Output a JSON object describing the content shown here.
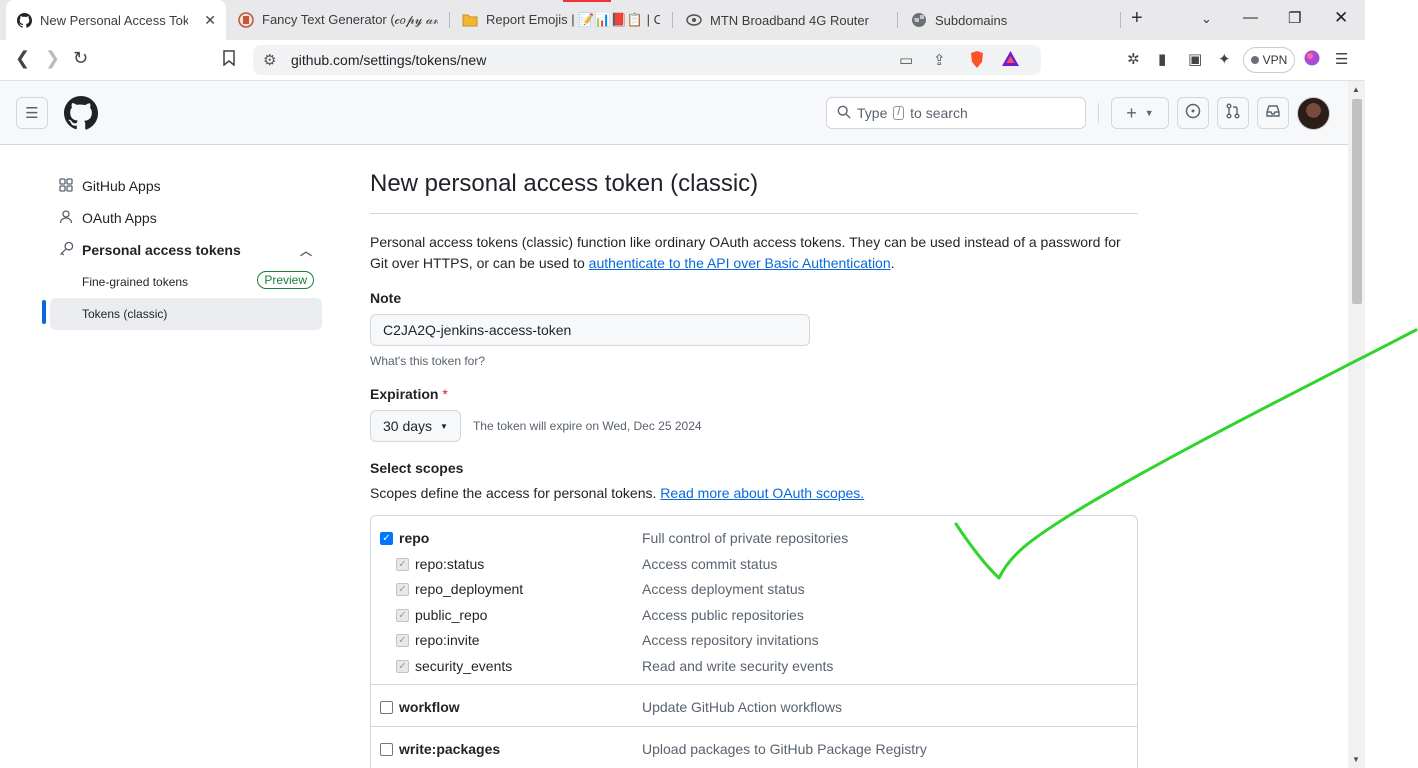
{
  "browser": {
    "tabs": [
      {
        "label": "New Personal Access Token (",
        "icon": "github-icon",
        "active": true
      },
      {
        "label": "Fancy Text Generator (𝒸𝑜𝓅𝓎 𝒶𝓃𝒹",
        "icon": "fancy-text-icon",
        "active": false
      },
      {
        "label": "Report Emojis | 📝📊📕📋 | Cop",
        "icon": "folder-icon",
        "active": false
      },
      {
        "label": "MTN Broadband 4G Router",
        "icon": "router-icon",
        "active": false
      },
      {
        "label": "Subdomains",
        "icon": "globe-icon",
        "active": false
      }
    ],
    "url": "github.com/settings/tokens/new",
    "vpn_label": "VPN"
  },
  "header": {
    "search_placeholder_before": "Type",
    "search_kbd": "/",
    "search_placeholder_after": "to search"
  },
  "sidebar": {
    "items": [
      {
        "label": "GitHub Apps",
        "icon": "apps-grid-icon"
      },
      {
        "label": "OAuth Apps",
        "icon": "person-icon"
      },
      {
        "label": "Personal access tokens",
        "icon": "key-icon"
      }
    ],
    "sub_items": [
      {
        "label": "Fine-grained tokens",
        "badge": "Preview"
      },
      {
        "label": "Tokens (classic)",
        "active": true
      }
    ]
  },
  "main": {
    "title": "New personal access token (classic)",
    "description": "Personal access tokens (classic) function like ordinary OAuth access tokens. They can be used instead of a password for Git over HTTPS, or can be used to",
    "description_link": "authenticate to the API over Basic Authentication",
    "description_end": ".",
    "note_label": "Note",
    "note_value": "C2JA2Q-jenkins-access-token",
    "note_hint": "What's this token for?",
    "expiration_label": "Expiration",
    "required_mark": "*",
    "expiration_value": "30 days",
    "expiration_note": "The token will expire on Wed, Dec 25 2024",
    "scopes_label": "Select scopes",
    "scopes_desc": "Scopes define the access for personal tokens.",
    "scopes_link": "Read more about OAuth scopes.",
    "scopes": [
      {
        "name": "repo",
        "desc": "Full control of private repositories",
        "checked": true
      },
      {
        "name": "repo:status",
        "desc": "Access commit status",
        "checked": true
      },
      {
        "name": "repo_deployment",
        "desc": "Access deployment status",
        "checked": true
      },
      {
        "name": "public_repo",
        "desc": "Access public repositories",
        "checked": true
      },
      {
        "name": "repo:invite",
        "desc": "Access repository invitations",
        "checked": true
      },
      {
        "name": "security_events",
        "desc": "Read and write security events",
        "checked": true
      },
      {
        "name": "workflow",
        "desc": "Update GitHub Action workflows",
        "checked": false
      },
      {
        "name": "write:packages",
        "desc": "Upload packages to GitHub Package Registry",
        "checked": false
      }
    ]
  },
  "annotation": {
    "color": "#2fd52a",
    "shape": "checkmark"
  },
  "colors": {
    "accent": "#0969da",
    "preview_badge": "#1a7f37",
    "checkbox": "#0075ff"
  }
}
